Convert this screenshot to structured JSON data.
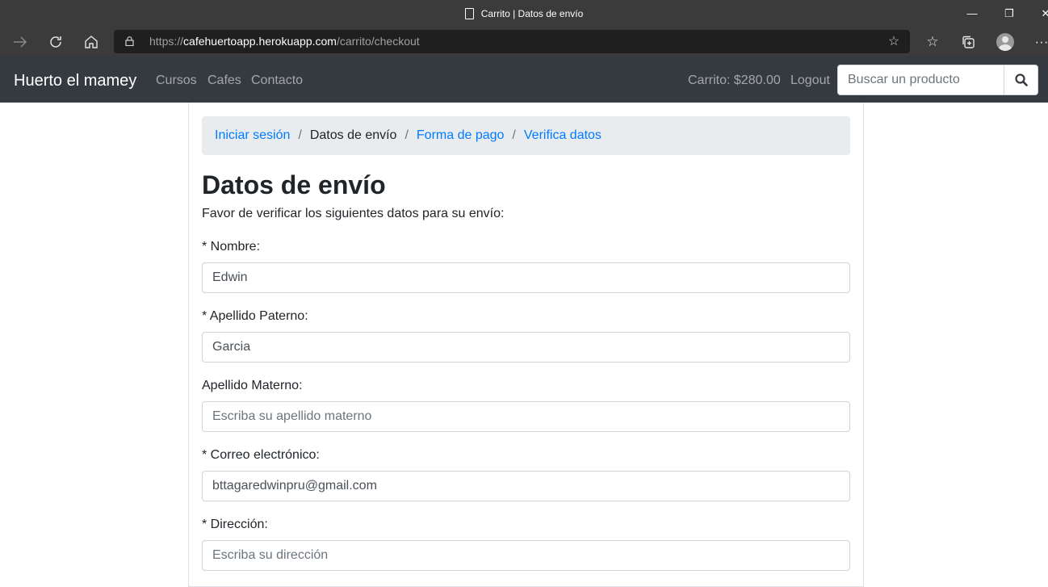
{
  "browser": {
    "tab_title": "Carrito | Datos de envío",
    "url_scheme": "https://",
    "url_host": "cafehuertoapp.herokuapp.com",
    "url_path": "/carrito/checkout",
    "window_controls": {
      "minimize": "—",
      "restore": "❐",
      "close": "✕"
    }
  },
  "navbar": {
    "brand": "Huerto el mamey",
    "links": [
      "Cursos",
      "Cafes",
      "Contacto"
    ],
    "cart": "Carrito: $280.00",
    "logout": "Logout",
    "search_placeholder": "Buscar un producto",
    "colors": {
      "bg": "#343a40"
    }
  },
  "breadcrumb": {
    "items": [
      "Iniciar sesión",
      "Datos de envío",
      "Forma de pago",
      "Verifica datos"
    ],
    "separator": "/"
  },
  "page": {
    "title": "Datos de envío",
    "subtitle": "Favor de verificar los siguientes datos para su envío:"
  },
  "form": {
    "fields": [
      {
        "label": "* Nombre:",
        "value": "Edwin",
        "placeholder": ""
      },
      {
        "label": "* Apellido Paterno:",
        "value": "Garcia",
        "placeholder": ""
      },
      {
        "label": "Apellido Materno:",
        "value": "",
        "placeholder": "Escriba su apellido materno"
      },
      {
        "label": "* Correo electrónico:",
        "value": "bttagaredwinpru@gmail.com",
        "placeholder": ""
      },
      {
        "label": "* Dirección:",
        "value": "",
        "placeholder": "Escriba su dirección"
      }
    ]
  },
  "colors": {
    "link": "#007bff",
    "text": "#212529",
    "breadcrumb_bg": "#e9ecef"
  }
}
